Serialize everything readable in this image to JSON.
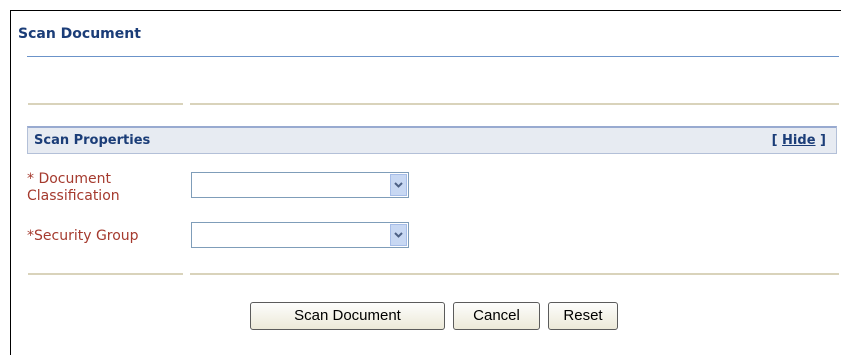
{
  "page": {
    "title": "Scan Document"
  },
  "section": {
    "title": "Scan Properties",
    "toggle_open": "[",
    "toggle_label": "Hide",
    "toggle_close": "]"
  },
  "fields": {
    "classification": {
      "label_line1": "* Document",
      "label_line2": "Classification",
      "value": ""
    },
    "security_group": {
      "label": "*Security Group",
      "value": ""
    }
  },
  "buttons": {
    "scan": "Scan Document",
    "cancel": "Cancel",
    "reset": "Reset"
  },
  "colors": {
    "heading": "#1b3d78",
    "required_label": "#a53a2e",
    "rule": "#6b93c9"
  }
}
